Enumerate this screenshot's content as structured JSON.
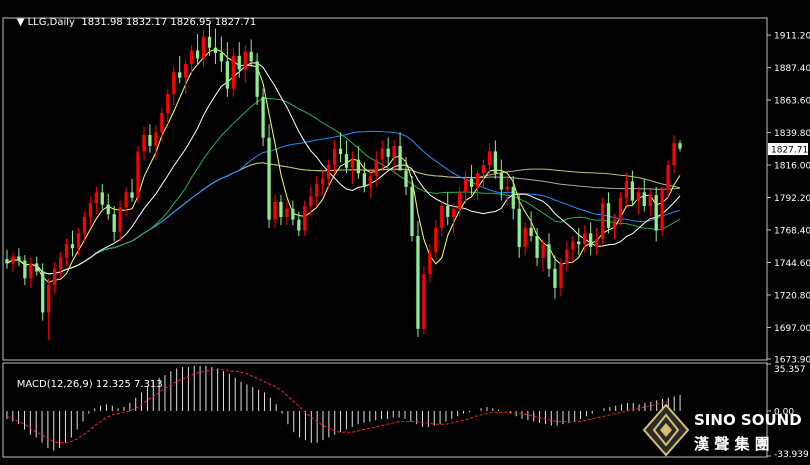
{
  "header": {
    "symbol": "LLG,Daily",
    "ohlc": "1831.98 1832.17 1826.95 1827.71"
  },
  "macd_header": {
    "label": "MACD(12,26,9)",
    "values": "12.325 7.313"
  },
  "colors": {
    "background": "#000000",
    "bull": "#ff0000",
    "bear": "#90ee90",
    "ma_fast": "#ffff66",
    "ma_white": "#ffffff",
    "ma_green": "#22b14c",
    "ma_blue": "#1e90ff",
    "ma_khaki": "#c8b878",
    "ma_gray": "#a9a9a9",
    "macd_hist": "#e0e0e0",
    "macd_signal": "#ff2020",
    "current_price_box": "#ffffff"
  },
  "logo": {
    "name": "SINO SOUND",
    "chinese": "漢 聲 集 團",
    "icon": "diamond-logo-icon"
  },
  "chart_data": [
    {
      "type": "candlestick",
      "title": "LLG,Daily",
      "ylim": [
        1673.9,
        1923.0
      ],
      "yticks": [
        "1911.20",
        "1887.40",
        "1863.60",
        "1839.80",
        "1816.00",
        "1792.20",
        "1768.40",
        "1744.60",
        "1720.80",
        "1697.00",
        "1673.90"
      ],
      "current_price_label": "1827.71",
      "grid": false,
      "candles": [
        [
          1747,
          1754,
          1740,
          1744
        ],
        [
          1744,
          1752,
          1738,
          1749
        ],
        [
          1749,
          1755,
          1742,
          1746
        ],
        [
          1746,
          1750,
          1728,
          1733
        ],
        [
          1733,
          1748,
          1726,
          1744
        ],
        [
          1744,
          1749,
          1735,
          1738
        ],
        [
          1738,
          1744,
          1702,
          1708
        ],
        [
          1708,
          1733,
          1688,
          1728
        ],
        [
          1728,
          1745,
          1722,
          1740
        ],
        [
          1740,
          1752,
          1734,
          1748
        ],
        [
          1748,
          1762,
          1742,
          1758
        ],
        [
          1758,
          1768,
          1749,
          1755
        ],
        [
          1755,
          1770,
          1750,
          1766
        ],
        [
          1766,
          1782,
          1760,
          1778
        ],
        [
          1778,
          1793,
          1771,
          1788
        ],
        [
          1788,
          1800,
          1780,
          1796
        ],
        [
          1796,
          1802,
          1784,
          1787
        ],
        [
          1787,
          1795,
          1776,
          1780
        ],
        [
          1780,
          1786,
          1760,
          1767
        ],
        [
          1767,
          1790,
          1760,
          1785
        ],
        [
          1785,
          1800,
          1778,
          1796
        ],
        [
          1796,
          1806,
          1789,
          1792
        ],
        [
          1792,
          1830,
          1788,
          1826
        ],
        [
          1826,
          1844,
          1819,
          1838
        ],
        [
          1838,
          1846,
          1825,
          1830
        ],
        [
          1830,
          1845,
          1820,
          1840
        ],
        [
          1840,
          1858,
          1833,
          1854
        ],
        [
          1854,
          1872,
          1846,
          1868
        ],
        [
          1868,
          1888,
          1860,
          1884
        ],
        [
          1884,
          1896,
          1876,
          1880
        ],
        [
          1880,
          1894,
          1868,
          1890
        ],
        [
          1890,
          1904,
          1882,
          1900
        ],
        [
          1900,
          1912,
          1890,
          1894
        ],
        [
          1894,
          1915,
          1888,
          1910
        ],
        [
          1910,
          1920,
          1896,
          1902
        ],
        [
          1902,
          1916,
          1890,
          1898
        ],
        [
          1898,
          1910,
          1884,
          1892
        ],
        [
          1892,
          1906,
          1866,
          1872
        ],
        [
          1872,
          1902,
          1866,
          1896
        ],
        [
          1896,
          1906,
          1880,
          1886
        ],
        [
          1886,
          1904,
          1876,
          1899
        ],
        [
          1899,
          1908,
          1888,
          1892
        ],
        [
          1892,
          1898,
          1860,
          1866
        ],
        [
          1866,
          1872,
          1830,
          1836
        ],
        [
          1836,
          1846,
          1770,
          1776
        ],
        [
          1776,
          1794,
          1770,
          1789
        ],
        [
          1789,
          1794,
          1772,
          1778
        ],
        [
          1778,
          1790,
          1772,
          1784
        ],
        [
          1784,
          1790,
          1772,
          1776
        ],
        [
          1776,
          1782,
          1764,
          1768
        ],
        [
          1768,
          1790,
          1764,
          1786
        ],
        [
          1786,
          1800,
          1779,
          1793
        ],
        [
          1793,
          1808,
          1786,
          1802
        ],
        [
          1802,
          1812,
          1794,
          1806
        ],
        [
          1806,
          1820,
          1800,
          1816
        ],
        [
          1816,
          1834,
          1810,
          1828
        ],
        [
          1828,
          1840,
          1818,
          1824
        ],
        [
          1824,
          1834,
          1810,
          1814
        ],
        [
          1814,
          1826,
          1802,
          1820
        ],
        [
          1820,
          1830,
          1806,
          1810
        ],
        [
          1810,
          1818,
          1796,
          1800
        ],
        [
          1800,
          1812,
          1792,
          1808
        ],
        [
          1808,
          1826,
          1800,
          1820
        ],
        [
          1820,
          1834,
          1812,
          1828
        ],
        [
          1828,
          1836,
          1816,
          1822
        ],
        [
          1822,
          1834,
          1810,
          1830
        ],
        [
          1830,
          1840,
          1816,
          1812
        ],
        [
          1812,
          1822,
          1794,
          1800
        ],
        [
          1800,
          1808,
          1760,
          1764
        ],
        [
          1764,
          1775,
          1690,
          1696
        ],
        [
          1696,
          1742,
          1692,
          1736
        ],
        [
          1736,
          1758,
          1730,
          1752
        ],
        [
          1752,
          1776,
          1746,
          1770
        ],
        [
          1770,
          1790,
          1764,
          1786
        ],
        [
          1786,
          1796,
          1772,
          1778
        ],
        [
          1778,
          1788,
          1766,
          1784
        ],
        [
          1784,
          1800,
          1778,
          1796
        ],
        [
          1796,
          1812,
          1788,
          1806
        ],
        [
          1806,
          1816,
          1794,
          1800
        ],
        [
          1800,
          1812,
          1790,
          1810
        ],
        [
          1810,
          1820,
          1800,
          1816
        ],
        [
          1816,
          1832,
          1806,
          1826
        ],
        [
          1826,
          1834,
          1806,
          1810
        ],
        [
          1810,
          1820,
          1790,
          1798
        ],
        [
          1798,
          1808,
          1786,
          1800
        ],
        [
          1800,
          1808,
          1776,
          1784
        ],
        [
          1784,
          1794,
          1748,
          1756
        ],
        [
          1756,
          1774,
          1750,
          1770
        ],
        [
          1770,
          1782,
          1760,
          1764
        ],
        [
          1764,
          1770,
          1742,
          1748
        ],
        [
          1748,
          1762,
          1738,
          1758
        ],
        [
          1758,
          1766,
          1734,
          1740
        ],
        [
          1740,
          1750,
          1718,
          1726
        ],
        [
          1726,
          1748,
          1720,
          1744
        ],
        [
          1744,
          1760,
          1738,
          1754
        ],
        [
          1754,
          1764,
          1746,
          1760
        ],
        [
          1760,
          1770,
          1750,
          1758
        ],
        [
          1758,
          1772,
          1752,
          1766
        ],
        [
          1766,
          1774,
          1750,
          1756
        ],
        [
          1756,
          1770,
          1750,
          1762
        ],
        [
          1762,
          1792,
          1758,
          1788
        ],
        [
          1788,
          1796,
          1766,
          1770
        ],
        [
          1770,
          1780,
          1762,
          1776
        ],
        [
          1776,
          1796,
          1772,
          1792
        ],
        [
          1792,
          1810,
          1786,
          1804
        ],
        [
          1804,
          1812,
          1786,
          1790
        ],
        [
          1790,
          1800,
          1780,
          1796
        ],
        [
          1796,
          1806,
          1782,
          1786
        ],
        [
          1786,
          1798,
          1778,
          1794
        ],
        [
          1794,
          1800,
          1760,
          1768
        ],
        [
          1768,
          1800,
          1764,
          1798
        ],
        [
          1798,
          1820,
          1792,
          1816
        ],
        [
          1816,
          1838,
          1810,
          1832
        ],
        [
          1832,
          1834,
          1826,
          1828
        ]
      ]
    },
    {
      "type": "bar",
      "title": "MACD(12,26,9)",
      "ylim": [
        -33.939,
        35.357
      ],
      "yticks": [
        "35.357",
        "0.00",
        "-33.939"
      ],
      "macd_value": 12.325,
      "signal_value": 7.313,
      "histogram": [
        -6,
        -8,
        -10,
        -14,
        -18,
        -20,
        -24,
        -28,
        -30,
        -28,
        -24,
        -20,
        -14,
        -8,
        -2,
        2,
        4,
        5,
        4,
        2,
        3,
        6,
        10,
        14,
        18,
        22,
        25,
        27,
        30,
        32,
        33,
        33,
        34,
        34,
        34,
        33,
        32,
        30,
        28,
        25,
        22,
        20,
        18,
        16,
        14,
        10,
        5,
        -2,
        -10,
        -16,
        -20,
        -22,
        -24,
        -24,
        -22,
        -20,
        -18,
        -16,
        -14,
        -12,
        -10,
        -9,
        -8,
        -7,
        -6,
        -6,
        -5,
        -5,
        -6,
        -8,
        -10,
        -12,
        -12,
        -11,
        -10,
        -8,
        -6,
        -4,
        -2,
        -1,
        0,
        2,
        3,
        2,
        1,
        0,
        -2,
        -4,
        -6,
        -7,
        -8,
        -9,
        -10,
        -11,
        -11,
        -10,
        -9,
        -8,
        -6,
        -4,
        -2,
        0,
        2,
        3,
        4,
        5,
        6,
        6,
        5,
        6,
        7,
        8,
        9,
        10,
        11,
        12
      ],
      "signal": [
        -4,
        -6,
        -8,
        -10,
        -13,
        -16,
        -18,
        -21,
        -23,
        -24,
        -24,
        -23,
        -21,
        -18,
        -15,
        -11,
        -8,
        -5,
        -3,
        -2,
        -1,
        0,
        2,
        5,
        8,
        11,
        14,
        17,
        20,
        22,
        24,
        26,
        28,
        29,
        30,
        31,
        31,
        31,
        30,
        30,
        29,
        28,
        26,
        24,
        22,
        20,
        18,
        15,
        11,
        7,
        3,
        -1,
        -5,
        -8,
        -11,
        -13,
        -15,
        -16,
        -16,
        -16,
        -15,
        -14,
        -13,
        -12,
        -11,
        -10,
        -9,
        -8,
        -8,
        -8,
        -8,
        -9,
        -9,
        -10,
        -10,
        -10,
        -9,
        -8,
        -7,
        -6,
        -4,
        -3,
        -2,
        -1,
        -1,
        -1,
        -1,
        -2,
        -2,
        -3,
        -4,
        -5,
        -6,
        -7,
        -8,
        -8,
        -8,
        -8,
        -8,
        -7,
        -6,
        -5,
        -4,
        -3,
        -2,
        -1,
        0,
        1,
        2,
        3,
        4,
        5,
        6,
        7
      ]
    }
  ]
}
